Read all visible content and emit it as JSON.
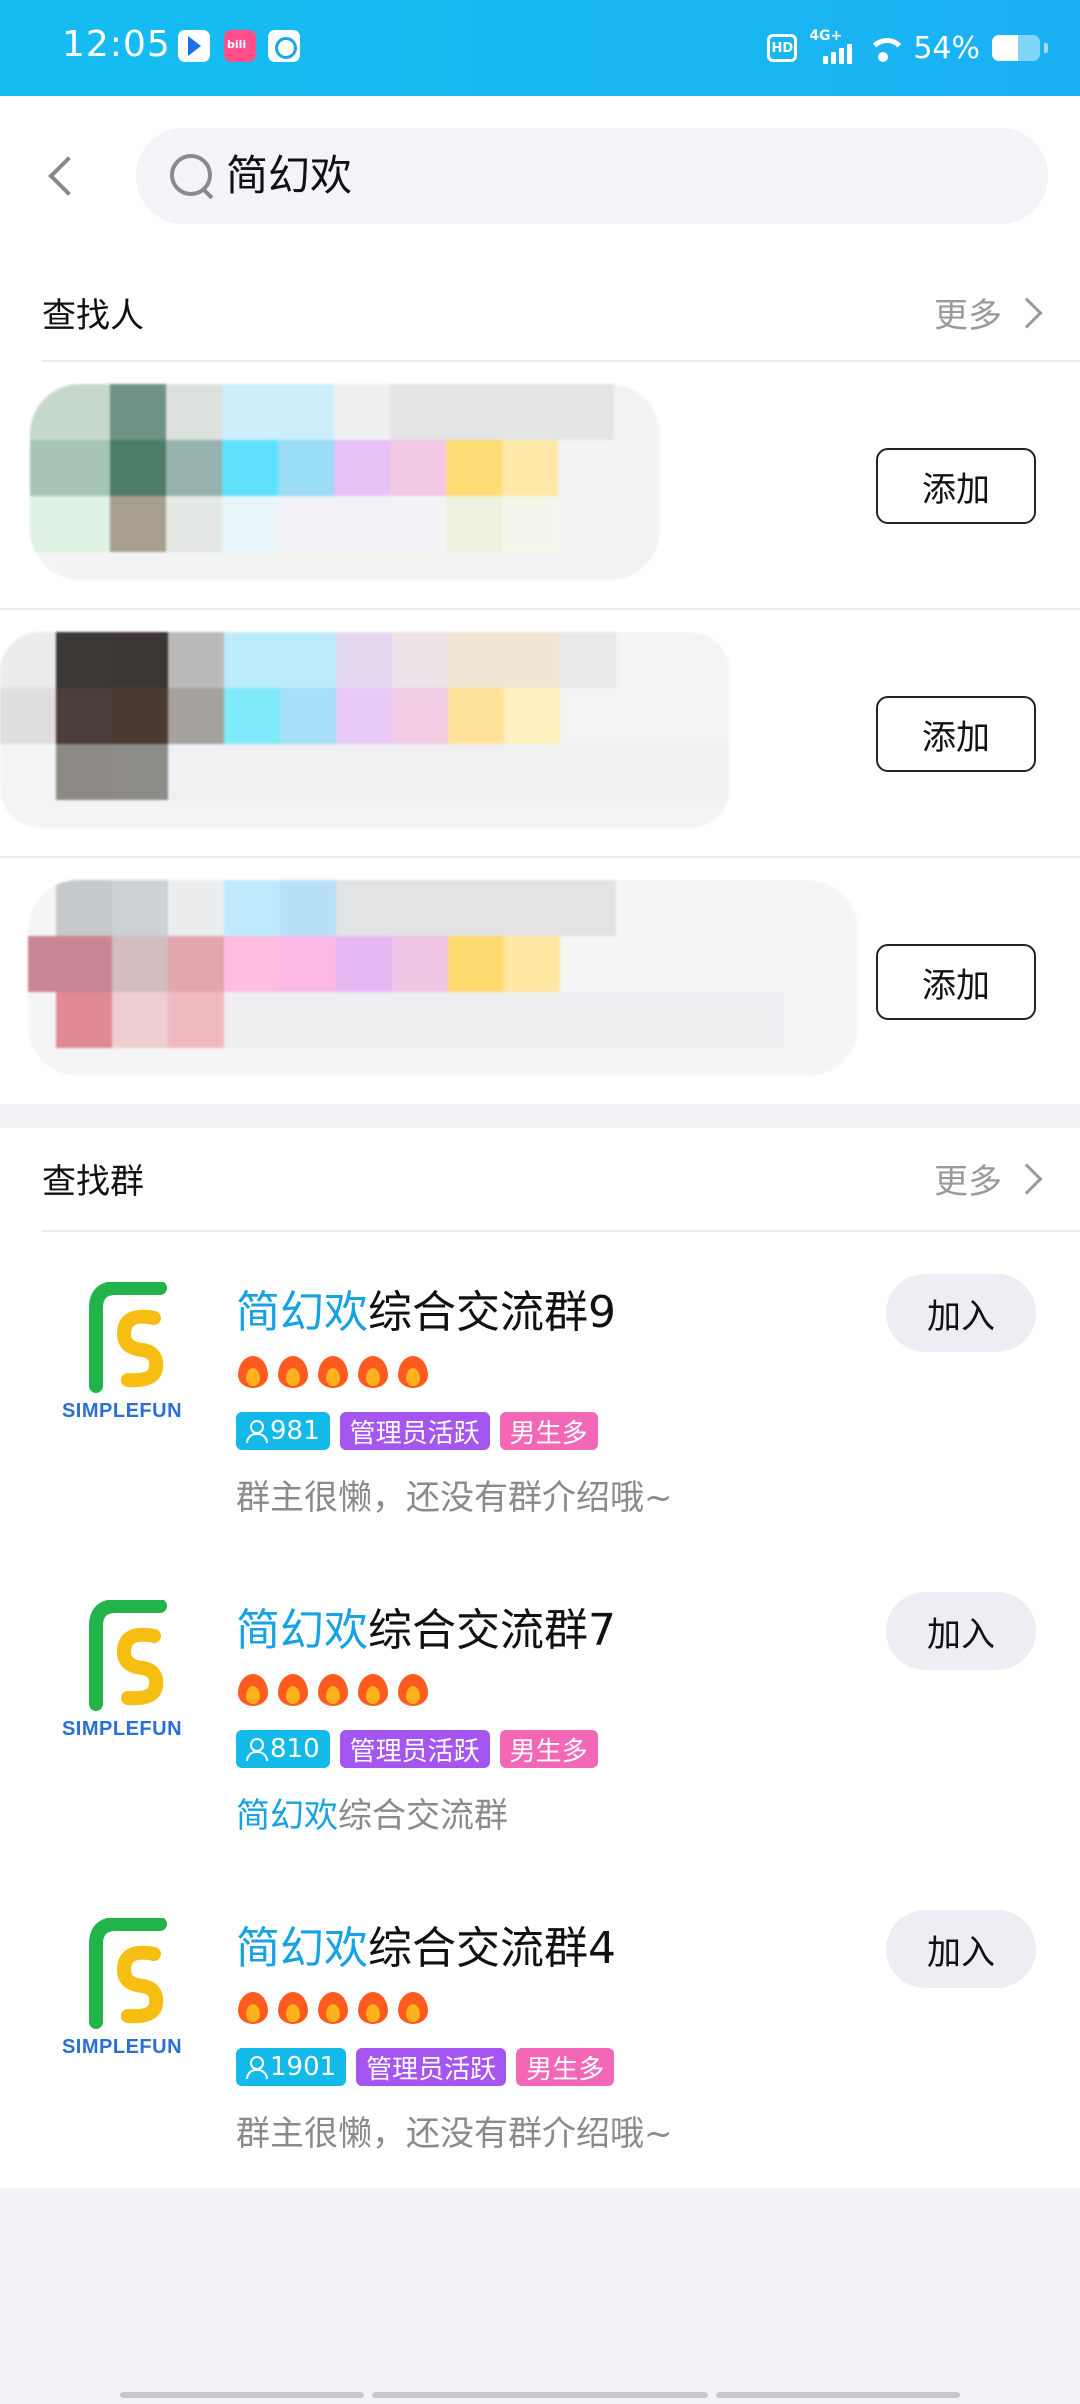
{
  "status_bar": {
    "time": "12:05",
    "app_icons": [
      "navigation-app-icon",
      "bilibili-app-icon",
      "camera-app-icon"
    ],
    "hd_label": "HD",
    "network_label": "4G+",
    "battery_percent": "54%",
    "battery_level": 0.54
  },
  "search": {
    "query": "简幻欢"
  },
  "people_section": {
    "title": "查找人",
    "more_label": "更多",
    "rows": [
      {
        "add_label": "添加"
      },
      {
        "add_label": "添加"
      },
      {
        "add_label": "添加"
      }
    ]
  },
  "group_section": {
    "title": "查找群",
    "more_label": "更多",
    "groups": [
      {
        "name_highlight": "简幻欢",
        "name_rest": "综合交流群9",
        "fire_count": 5,
        "members": "981",
        "tags": [
          "管理员活跃",
          "男生多"
        ],
        "desc_highlight": "",
        "desc_rest": "群主很懒，还没有群介绍哦~",
        "logo_text": "SIMPLEFUN",
        "join_label": "加入"
      },
      {
        "name_highlight": "简幻欢",
        "name_rest": "综合交流群7",
        "fire_count": 5,
        "members": "810",
        "tags": [
          "管理员活跃",
          "男生多"
        ],
        "desc_highlight": "简幻欢",
        "desc_rest": "综合交流群",
        "logo_text": "SIMPLEFUN",
        "join_label": "加入"
      },
      {
        "name_highlight": "简幻欢",
        "name_rest": "综合交流群4",
        "fire_count": 5,
        "members": "1901",
        "tags": [
          "管理员活跃",
          "男生多"
        ],
        "desc_highlight": "",
        "desc_rest": "群主很懒，还没有群介绍哦~",
        "logo_text": "SIMPLEFUN",
        "join_label": "加入"
      }
    ]
  },
  "colors": {
    "accent": "#16a2e3",
    "status_bar": "#15bdf1",
    "tag_members": "#13b9e8",
    "tag_admin": "#a556f0",
    "tag_male": "#f268b6"
  }
}
